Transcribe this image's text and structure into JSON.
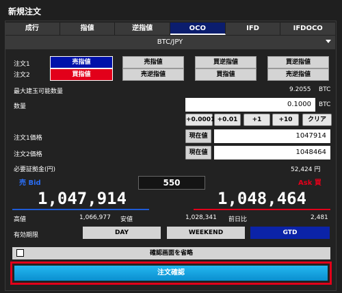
{
  "title": "新規注文",
  "tabs": [
    "成行",
    "指値",
    "逆指値",
    "OCO",
    "IFD",
    "IFDOCO"
  ],
  "active_tab": "OCO",
  "pair": "BTC/JPY",
  "order1_label": "注文1",
  "order2_label": "注文2",
  "side_sell": "売指値",
  "side_buy": "買指値",
  "options": [
    {
      "top": "売指値",
      "bottom": "売逆指値"
    },
    {
      "top": "買逆指値",
      "bottom": "買指値"
    },
    {
      "top": "買逆指値",
      "bottom": "売逆指値"
    }
  ],
  "max_qty_label": "最大建玉可能数量",
  "max_qty_value": "9.2055",
  "max_qty_unit": "BTC",
  "qty_label": "数量",
  "qty_value": "0.1000",
  "qty_unit": "BTC",
  "step_buttons": [
    "+0.0001",
    "+0.01",
    "+1",
    "+10",
    "クリア"
  ],
  "price1_label": "注文1価格",
  "price2_label": "注文2価格",
  "current_price_btn": "現在値",
  "price1_value": "1047914",
  "price2_value": "1048464",
  "margin_label": "必要証拠金(円)",
  "margin_value": "52,424 円",
  "bid_label": "売 Bid",
  "ask_label": "Ask 買",
  "spread": "550",
  "bid_price": "1,047,914",
  "ask_price": "1,048,464",
  "high_label": "高値",
  "high_value": "1,066,977",
  "low_label": "安値",
  "low_value": "1,028,341",
  "change_label": "前日比",
  "change_value": "2,481",
  "validity_label": "有効期限",
  "validity_options": [
    "DAY",
    "WEEKEND",
    "GTD"
  ],
  "validity_selected": "GTD",
  "skip_confirm_label": "確認画面を省略",
  "confirm_button": "注文確認",
  "colors": {
    "sell": "#0011aa",
    "buy": "#e2001a",
    "accent": "#25b7f0"
  }
}
